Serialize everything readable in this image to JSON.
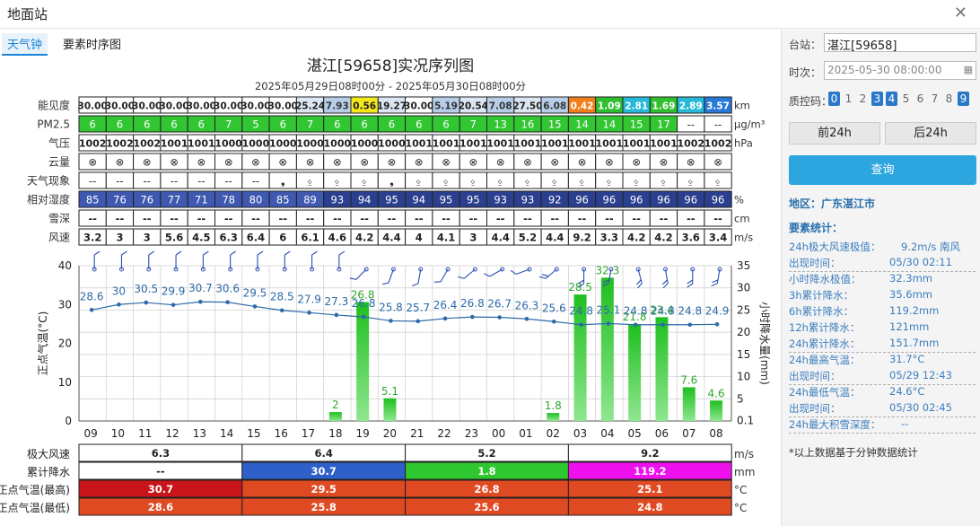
{
  "window": {
    "title": "地面站",
    "close_icon": "close-icon"
  },
  "tabs": [
    {
      "label": "天气钟"
    },
    {
      "label": "要素时序图"
    }
  ],
  "sidebar": {
    "station_label": "台站：",
    "station_value": "湛江[59658]",
    "time_label": "时次：",
    "time_value": "2025-05-30 08:00:00",
    "qc_label": "质控码：",
    "qc_codes": [
      {
        "v": "0",
        "on": true
      },
      {
        "v": "1",
        "on": false
      },
      {
        "v": "2",
        "on": false
      },
      {
        "v": "3",
        "on": true
      },
      {
        "v": "4",
        "on": true
      },
      {
        "v": "5",
        "on": false
      },
      {
        "v": "6",
        "on": false
      },
      {
        "v": "7",
        "on": false
      },
      {
        "v": "8",
        "on": false
      },
      {
        "v": "9",
        "on": true
      }
    ],
    "prev_label": "前24h",
    "next_label": "后24h",
    "query_label": "查询",
    "region": "地区：广东湛江市",
    "stats_title": "要素统计：",
    "stats": [
      {
        "k": "24h极大风速极值：",
        "v": "9.2m/s 南风",
        "wide": true,
        "dash": false
      },
      {
        "k": "出现时间：",
        "v": "05/30 02:11",
        "dash": true
      },
      {
        "k": "小时降水极值：",
        "v": "32.3mm",
        "dash": false
      },
      {
        "k": "3h累计降水：",
        "v": "35.6mm",
        "dash": false
      },
      {
        "k": "6h累计降水：",
        "v": "119.2mm",
        "dash": false
      },
      {
        "k": "12h累计降水：",
        "v": "121mm",
        "dash": false
      },
      {
        "k": "24h累计降水：",
        "v": "151.7mm",
        "dash": true
      },
      {
        "k": "24h最高气温：",
        "v": "31.7°C",
        "dash": false
      },
      {
        "k": "出现时间：",
        "v": "05/29 12:43",
        "dash": true
      },
      {
        "k": "24h最低气温：",
        "v": "24.6°C",
        "dash": false
      },
      {
        "k": "出现时间：",
        "v": "05/30 02:45",
        "dash": true
      },
      {
        "k": "24h最大积雪深度：",
        "v": "--",
        "wide": true,
        "dash": true
      }
    ],
    "note": "*以上数据基于分钟数据统计"
  },
  "chart_data": {
    "type": "bar+line",
    "title": "湛江[59658]实况序列图",
    "subtitle": "2025年05月29日08时00分 - 2025年05月30日08时00分",
    "hours": [
      "09",
      "10",
      "11",
      "12",
      "13",
      "14",
      "15",
      "16",
      "17",
      "18",
      "19",
      "20",
      "21",
      "22",
      "23",
      "00",
      "01",
      "02",
      "03",
      "04",
      "05",
      "06",
      "07",
      "08"
    ],
    "table_rows": [
      {
        "label": "能见度",
        "unit": "km",
        "kind": "vis",
        "values": [
          "30.00",
          "30.00",
          "30.00",
          "30.00",
          "30.00",
          "30.00",
          "30.00",
          "30.00",
          "25.24",
          "7.93",
          "0.56",
          "19.27",
          "30.00",
          "5.19",
          "20.54",
          "7.08",
          "27.50",
          "6.08",
          "0.42",
          "1.09",
          "2.81",
          "1.69",
          "2.89",
          "3.57"
        ]
      },
      {
        "label": "PM2.5",
        "unit": "μg/m³",
        "kind": "pm",
        "values": [
          "6",
          "6",
          "6",
          "6",
          "6",
          "7",
          "5",
          "6",
          "7",
          "6",
          "6",
          "6",
          "6",
          "6",
          "7",
          "13",
          "16",
          "15",
          "14",
          "14",
          "15",
          "17",
          "--",
          "--"
        ]
      },
      {
        "label": "气压",
        "unit": "hPa",
        "kind": "plain",
        "values": [
          "1002",
          "1002",
          "1002",
          "1001",
          "1001",
          "1000",
          "1000",
          "1000",
          "1000",
          "1000",
          "1000",
          "1000",
          "1001",
          "1001",
          "1001",
          "1001",
          "1001",
          "1001",
          "1001",
          "1001",
          "1001",
          "1001",
          "1002",
          "1002"
        ]
      },
      {
        "label": "云量",
        "unit": "",
        "kind": "cloud",
        "values": [
          "⊗",
          "⊗",
          "⊗",
          "⊗",
          "⊗",
          "⊗",
          "⊗",
          "⊗",
          "⊗",
          "⊗",
          "⊗",
          "⊗",
          "⊗",
          "⊗",
          "⊗",
          "⊗",
          "⊗",
          "⊗",
          "⊗",
          "⊗",
          "⊗",
          "⊗",
          "⊗",
          "⊗"
        ]
      },
      {
        "label": "天气现象",
        "unit": "",
        "kind": "wx",
        "values": [
          "--",
          "--",
          "--",
          "--",
          "--",
          "--",
          "--",
          "❟",
          "⍚",
          "⍚",
          "⍚",
          "❟",
          "⍚",
          "⍚",
          "⍚",
          "⍚",
          "⍚",
          "⍚",
          "⍚",
          "⍚",
          "⍚",
          "⍚",
          "⍚",
          "⍚"
        ]
      },
      {
        "label": "相对湿度",
        "unit": "%",
        "kind": "rh",
        "values": [
          "85",
          "76",
          "76",
          "77",
          "71",
          "78",
          "80",
          "85",
          "89",
          "93",
          "94",
          "95",
          "94",
          "95",
          "95",
          "93",
          "93",
          "92",
          "96",
          "96",
          "96",
          "96",
          "96",
          "96"
        ]
      },
      {
        "label": "雪深",
        "unit": "cm",
        "kind": "plain",
        "values": [
          "--",
          "--",
          "--",
          "--",
          "--",
          "--",
          "--",
          "--",
          "--",
          "--",
          "--",
          "--",
          "--",
          "--",
          "--",
          "--",
          "--",
          "--",
          "--",
          "--",
          "--",
          "--",
          "--",
          "--"
        ]
      },
      {
        "label": "风速",
        "unit": "m/s",
        "kind": "plain",
        "values": [
          "3.2",
          "3",
          "3",
          "5.6",
          "4.5",
          "6.3",
          "6.4",
          "6",
          "6.1",
          "4.6",
          "4.2",
          "4.4",
          "4",
          "4.1",
          "3",
          "4.4",
          "5.2",
          "4.4",
          "9.2",
          "3.3",
          "4.2",
          "4.2",
          "3.6",
          "3.4"
        ]
      }
    ],
    "temperature": [
      28.6,
      30,
      30.5,
      29.9,
      30.7,
      30.6,
      29.5,
      28.5,
      27.9,
      27.3,
      26.8,
      25.8,
      25.7,
      26.4,
      26.8,
      26.7,
      26.3,
      25.6,
      24.8,
      25.1,
      24.8,
      24.8,
      24.8,
      24.9
    ],
    "temperature_labels": [
      "28.6",
      "30",
      "30.5",
      "29.9",
      "30.7",
      "30.6",
      "29.5",
      "28.5",
      "27.9",
      "27.3",
      "26.8",
      "25.8",
      "25.7",
      "26.4",
      "26.8",
      "26.7",
      "26.3",
      "25.6",
      "24.8",
      "25.1",
      "24.8",
      "24.8",
      "24.8",
      "24.9"
    ],
    "precip": [
      0,
      0,
      0,
      0,
      0,
      0,
      0,
      0,
      0,
      2,
      26.8,
      5.1,
      0,
      0,
      0,
      0,
      0,
      1.8,
      28.5,
      32.3,
      21.8,
      23.4,
      7.6,
      4.6
    ],
    "precip_labels": [
      "",
      "",
      "",
      "",
      "",
      "",
      "",
      "",
      "",
      "2",
      "26.8",
      "5.1",
      "",
      "",
      "",
      "",
      "",
      "1.8",
      "28.5",
      "32.3",
      "21.8",
      "23.4",
      "7.6",
      "4.6"
    ],
    "wind_dir_deg": [
      0,
      0,
      0,
      0,
      0,
      0,
      0,
      0,
      0,
      0,
      225,
      200,
      190,
      210,
      230,
      240,
      250,
      230,
      180,
      190,
      165,
      170,
      180,
      190
    ],
    "yleft": {
      "label": "正点气温(°C)",
      "ticks": [
        "0",
        "10",
        "20",
        "30",
        "40"
      ],
      "min": 0,
      "max": 40
    },
    "yright": {
      "label": "小时降水量(mm)",
      "ticks": [
        "0.1",
        "5",
        "10",
        "15",
        "20",
        "25",
        "30",
        "35"
      ],
      "min": 0,
      "max": 35
    },
    "summary": [
      {
        "label": "极大风速",
        "unit": "m/s",
        "cells": [
          {
            "v": "6.3",
            "bg": "#ffffff",
            "fg": "#222"
          },
          {
            "v": "6.4",
            "bg": "#ffffff",
            "fg": "#222"
          },
          {
            "v": "5.2",
            "bg": "#ffffff",
            "fg": "#222"
          },
          {
            "v": "9.2",
            "bg": "#ffffff",
            "fg": "#222"
          }
        ]
      },
      {
        "label": "累计降水",
        "unit": "mm",
        "cells": [
          {
            "v": "--",
            "bg": "#ffffff",
            "fg": "#222"
          },
          {
            "v": "30.7",
            "bg": "#2f5fc8",
            "fg": "#fff"
          },
          {
            "v": "1.8",
            "bg": "#2fc72f",
            "fg": "#fff"
          },
          {
            "v": "119.2",
            "bg": "#ee11ee",
            "fg": "#fff"
          }
        ]
      },
      {
        "label": "正点气温(最高)",
        "unit": "°C",
        "cells": [
          {
            "v": "30.7",
            "bg": "#c8141a",
            "fg": "#fff"
          },
          {
            "v": "29.5",
            "bg": "#e04a22",
            "fg": "#fff"
          },
          {
            "v": "26.8",
            "bg": "#e04a22",
            "fg": "#fff"
          },
          {
            "v": "25.1",
            "bg": "#e04a22",
            "fg": "#fff"
          }
        ]
      },
      {
        "label": "正点气温(最低)",
        "unit": "°C",
        "cells": [
          {
            "v": "28.6",
            "bg": "#e04a22",
            "fg": "#fff"
          },
          {
            "v": "25.8",
            "bg": "#e04a22",
            "fg": "#fff"
          },
          {
            "v": "25.6",
            "bg": "#e04a22",
            "fg": "#fff"
          },
          {
            "v": "24.8",
            "bg": "#e04a22",
            "fg": "#fff"
          }
        ]
      }
    ],
    "colors": {
      "temp_line": "#2c6aa8",
      "bar": "#33c633",
      "barlabel": "#2ea82e",
      "grid": "#cccccc",
      "wind": "#2c4fb5"
    }
  }
}
